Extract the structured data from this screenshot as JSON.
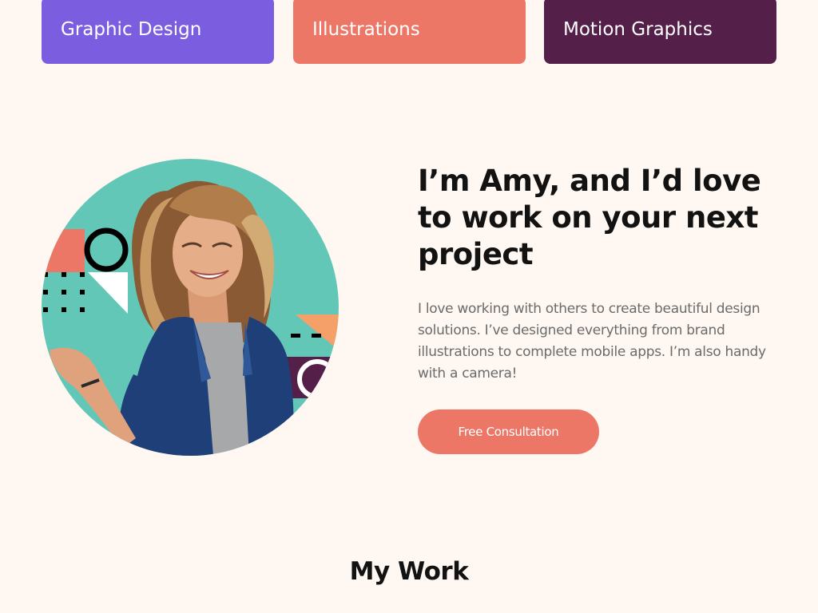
{
  "categories": [
    {
      "label": "Graphic Design",
      "color": "#7B5EE0"
    },
    {
      "label": "Illustrations",
      "color": "#EC7766"
    },
    {
      "label": "Motion Graphics",
      "color": "#54204A"
    }
  ],
  "hero": {
    "headline": "I’m Amy, and I’d love to work on your next project",
    "bio": "I love working with others to create beautiful design solutions. I’ve designed everything from brand illustrations to complete mobile apps. I’m also handy with a camera!",
    "cta_label": "Free Consultation"
  },
  "work": {
    "title": "My Work"
  },
  "colors": {
    "background": "#FFF7F1",
    "accent": "#EC7766",
    "teal": "#63C7B8",
    "purple": "#7B5EE0",
    "plum": "#54204A"
  }
}
